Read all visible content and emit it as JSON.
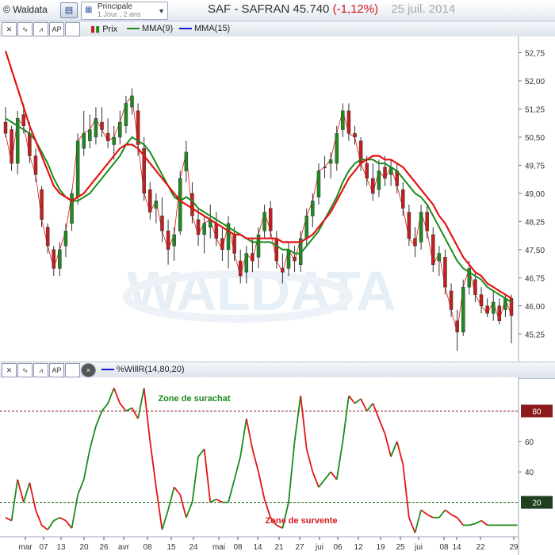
{
  "app": {
    "brand": "© Waldata",
    "preset": "Principale",
    "preset_sub": "1 Jour , 2 ans",
    "title_main": "SAF - SAFRAN  45.740",
    "title_change": "(-1,12%)",
    "title_date": "25 juil. 2014"
  },
  "toolbar_top": {
    "legend": [
      "Prix",
      "MMA(9)",
      "MMA(15)"
    ]
  },
  "toolbar_bottom": {
    "legend": [
      "%WillR(14,80,20)"
    ]
  },
  "colors": {
    "up": "#1f8a1f",
    "down": "#c41f1f",
    "ma9": "#1d8a1d",
    "ma15": "#e31414",
    "thin": "#e31414"
  },
  "chart_data": [
    {
      "type": "candlestick",
      "title": "SAF - SAFRAN",
      "ylim": [
        44.6,
        53.1
      ],
      "yticks": [
        "52,75",
        "52,00",
        "51,25",
        "50,50",
        "49,75",
        "49,00",
        "48,25",
        "47,50",
        "46,75",
        "46,00",
        "45,25"
      ],
      "xticks": [
        "mar",
        "07",
        "13",
        "20",
        "26",
        "avr",
        "08",
        "15",
        "24",
        "mai",
        "08",
        "14",
        "21",
        "27",
        "jui",
        "06",
        "12",
        "19",
        "25",
        "jui",
        "08",
        "14",
        "22",
        "29"
      ],
      "candles": [
        [
          50.9,
          51.3,
          50.5,
          50.6
        ],
        [
          50.7,
          50.8,
          49.6,
          49.8
        ],
        [
          49.8,
          51.2,
          49.5,
          51.0
        ],
        [
          51.1,
          51.4,
          50.6,
          50.8
        ],
        [
          50.6,
          50.9,
          49.8,
          50.0
        ],
        [
          50.0,
          50.2,
          49.3,
          49.5
        ],
        [
          49.1,
          49.2,
          48.1,
          48.3
        ],
        [
          48.1,
          48.2,
          47.4,
          47.6
        ],
        [
          47.5,
          47.6,
          46.8,
          47.0
        ],
        [
          47.0,
          47.7,
          46.8,
          47.5
        ],
        [
          47.6,
          48.2,
          47.3,
          48.0
        ],
        [
          48.2,
          49.1,
          48.0,
          49.0
        ],
        [
          48.9,
          50.6,
          48.7,
          50.4
        ],
        [
          50.2,
          51.2,
          50.0,
          50.6
        ],
        [
          50.4,
          51.1,
          50.2,
          50.7
        ],
        [
          50.5,
          51.3,
          50.3,
          51.0
        ],
        [
          50.9,
          51.3,
          50.5,
          50.7
        ],
        [
          50.6,
          51.0,
          50.2,
          50.4
        ],
        [
          50.3,
          50.8,
          49.9,
          50.5
        ],
        [
          50.5,
          51.2,
          50.3,
          50.9
        ],
        [
          50.8,
          51.6,
          50.6,
          51.4
        ],
        [
          51.3,
          51.8,
          51.1,
          51.6
        ],
        [
          51.2,
          51.4,
          50.0,
          50.3
        ],
        [
          50.2,
          50.5,
          48.8,
          49.0
        ],
        [
          49.1,
          49.3,
          48.3,
          48.5
        ],
        [
          48.6,
          49.0,
          48.2,
          48.8
        ],
        [
          48.4,
          48.9,
          47.7,
          48.0
        ],
        [
          48.0,
          48.3,
          47.1,
          47.5
        ],
        [
          47.6,
          48.1,
          47.2,
          47.9
        ],
        [
          48.0,
          49.6,
          47.9,
          49.4
        ],
        [
          49.6,
          50.4,
          49.3,
          50.1
        ],
        [
          49.0,
          49.3,
          48.2,
          48.4
        ],
        [
          48.3,
          48.6,
          47.6,
          47.9
        ],
        [
          47.9,
          48.4,
          47.4,
          48.2
        ],
        [
          48.1,
          48.7,
          47.8,
          48.3
        ],
        [
          48.2,
          48.5,
          47.6,
          47.8
        ],
        [
          47.8,
          48.1,
          47.2,
          47.5
        ],
        [
          47.5,
          48.4,
          47.0,
          48.2
        ],
        [
          47.9,
          48.1,
          47.2,
          47.4
        ],
        [
          47.2,
          47.5,
          46.6,
          46.8
        ],
        [
          46.9,
          47.6,
          46.6,
          47.4
        ],
        [
          47.4,
          47.8,
          46.9,
          47.2
        ],
        [
          47.3,
          48.1,
          47.0,
          47.9
        ],
        [
          48.0,
          48.7,
          47.8,
          48.5
        ],
        [
          48.6,
          48.8,
          47.8,
          48.0
        ],
        [
          47.8,
          48.0,
          47.0,
          47.2
        ],
        [
          47.0,
          47.4,
          46.6,
          46.9
        ],
        [
          47.0,
          47.7,
          46.8,
          47.5
        ],
        [
          47.3,
          47.6,
          46.9,
          47.2
        ],
        [
          47.1,
          48.0,
          46.9,
          47.8
        ],
        [
          47.8,
          48.6,
          47.6,
          48.4
        ],
        [
          48.4,
          49.0,
          48.1,
          48.8
        ],
        [
          48.9,
          49.8,
          48.7,
          49.6
        ],
        [
          49.7,
          50.0,
          49.4,
          49.7
        ],
        [
          49.8,
          50.1,
          49.4,
          49.9
        ],
        [
          49.8,
          50.8,
          49.6,
          50.6
        ],
        [
          50.7,
          51.4,
          50.5,
          51.2
        ],
        [
          51.2,
          51.4,
          50.4,
          50.6
        ],
        [
          50.6,
          50.8,
          50.3,
          50.5
        ],
        [
          50.4,
          50.5,
          49.6,
          49.8
        ],
        [
          49.8,
          50.0,
          49.2,
          49.4
        ],
        [
          49.4,
          49.8,
          48.8,
          49.0
        ],
        [
          49.1,
          49.9,
          48.9,
          49.6
        ],
        [
          49.7,
          50.0,
          49.2,
          49.4
        ],
        [
          49.5,
          49.9,
          49.2,
          49.7
        ],
        [
          49.6,
          49.8,
          49.0,
          49.2
        ],
        [
          49.1,
          49.3,
          48.4,
          48.6
        ],
        [
          48.5,
          48.7,
          47.6,
          47.8
        ],
        [
          47.8,
          48.1,
          47.3,
          47.6
        ],
        [
          47.7,
          48.7,
          47.5,
          48.5
        ],
        [
          48.5,
          48.7,
          47.8,
          48.0
        ],
        [
          47.9,
          48.1,
          46.9,
          47.1
        ],
        [
          47.2,
          47.6,
          46.8,
          47.4
        ],
        [
          47.3,
          47.5,
          46.3,
          46.5
        ],
        [
          46.4,
          46.6,
          45.7,
          45.9
        ],
        [
          45.6,
          45.9,
          44.8,
          45.3
        ],
        [
          45.3,
          46.7,
          45.2,
          46.5
        ],
        [
          46.5,
          47.2,
          46.3,
          47.0
        ],
        [
          46.7,
          46.9,
          46.1,
          46.3
        ],
        [
          46.3,
          46.5,
          45.8,
          46.0
        ],
        [
          46.0,
          46.2,
          45.7,
          45.8
        ],
        [
          45.8,
          46.4,
          45.6,
          46.1
        ],
        [
          46.0,
          46.2,
          45.5,
          45.6
        ],
        [
          45.9,
          46.3,
          45.7,
          46.2
        ],
        [
          46.2,
          46.3,
          45.0,
          45.74
        ]
      ],
      "ma9": [
        51.0,
        50.9,
        50.8,
        50.7,
        50.6,
        50.4,
        50.1,
        49.8,
        49.4,
        49.1,
        48.9,
        48.8,
        48.8,
        48.9,
        49.0,
        49.2,
        49.4,
        49.6,
        49.8,
        50.0,
        50.3,
        50.5,
        50.4,
        50.3,
        50.1,
        49.8,
        49.5,
        49.2,
        48.9,
        48.8,
        48.9,
        48.8,
        48.6,
        48.5,
        48.4,
        48.3,
        48.2,
        48.1,
        48.0,
        47.9,
        47.8,
        47.7,
        47.7,
        47.7,
        47.7,
        47.6,
        47.5,
        47.5,
        47.4,
        47.4,
        47.6,
        47.8,
        48.0,
        48.3,
        48.6,
        48.9,
        49.3,
        49.6,
        49.8,
        49.9,
        49.9,
        49.9,
        49.8,
        49.8,
        49.7,
        49.6,
        49.4,
        49.2,
        49.0,
        48.9,
        48.7,
        48.4,
        48.1,
        47.8,
        47.5,
        47.2,
        47.0,
        46.9,
        46.8,
        46.7,
        46.5,
        46.4,
        46.3,
        46.2,
        46.1
      ],
      "ma15": [
        52.8,
        52.3,
        51.8,
        51.3,
        50.8,
        50.4,
        50.0,
        49.6,
        49.2,
        49.0,
        48.9,
        48.8,
        48.9,
        49.0,
        49.2,
        49.4,
        49.6,
        49.8,
        50.0,
        50.2,
        50.3,
        50.3,
        50.2,
        50.0,
        49.8,
        49.6,
        49.4,
        49.2,
        49.0,
        48.8,
        48.7,
        48.6,
        48.5,
        48.4,
        48.3,
        48.2,
        48.1,
        48.0,
        47.9,
        47.9,
        47.8,
        47.8,
        47.8,
        47.8,
        47.8,
        47.8,
        47.7,
        47.7,
        47.7,
        47.7,
        47.8,
        47.9,
        48.1,
        48.3,
        48.5,
        48.8,
        49.1,
        49.4,
        49.6,
        49.8,
        49.9,
        50.0,
        50.0,
        49.9,
        49.9,
        49.8,
        49.7,
        49.5,
        49.3,
        49.1,
        48.9,
        48.7,
        48.4,
        48.2,
        47.9,
        47.6,
        47.3,
        47.1,
        46.9,
        46.8,
        46.6,
        46.5,
        46.4,
        46.3,
        46.2
      ]
    },
    {
      "type": "line",
      "title": "%WillR(14,80,20)",
      "ylim": [
        0,
        100
      ],
      "yticks": [
        "80",
        "60",
        "40",
        "20"
      ],
      "levels": [
        80,
        20
      ],
      "zone_labels": [
        "Zone de surachat",
        "Zone de survente"
      ],
      "values": [
        10,
        8,
        35,
        20,
        33,
        15,
        5,
        2,
        8,
        10,
        8,
        3,
        25,
        35,
        55,
        70,
        80,
        85,
        95,
        85,
        80,
        82,
        75,
        95,
        60,
        30,
        2,
        15,
        30,
        25,
        10,
        20,
        50,
        55,
        20,
        22,
        20,
        20,
        35,
        50,
        75,
        55,
        40,
        22,
        10,
        5,
        3,
        20,
        60,
        90,
        55,
        40,
        30,
        35,
        40,
        35,
        60,
        90,
        85,
        88,
        80,
        85,
        75,
        65,
        50,
        60,
        45,
        10,
        0,
        15,
        12,
        10,
        10,
        15,
        12,
        10,
        5,
        5,
        6,
        8,
        5,
        5,
        5,
        5,
        5,
        5
      ]
    }
  ]
}
